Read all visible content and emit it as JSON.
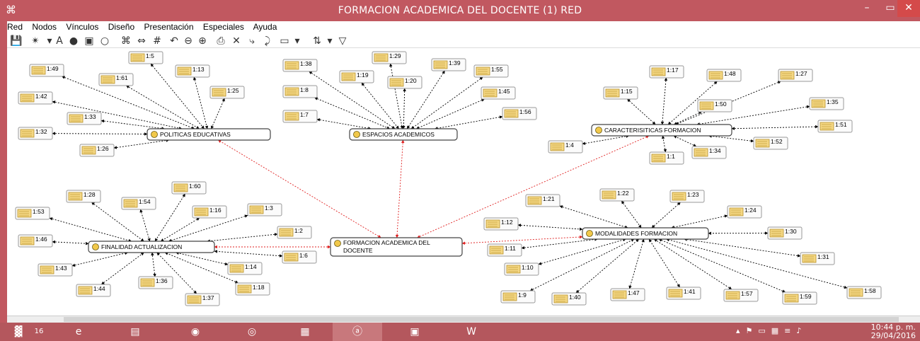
{
  "title": "FORMACION ACADEMICA DEL DOCENTE (1) RED",
  "menu": [
    "Red",
    "Nodos",
    "Vínculos",
    "Diseño",
    "Presentación",
    "Especiales",
    "Ayuda"
  ],
  "codes": [
    {
      "id": "politicas",
      "label": "POLITICAS EDUCATIVAS"
    },
    {
      "id": "espacios",
      "label": "ESPACIOS ACADEMICOS"
    },
    {
      "id": "caracteristicas",
      "label": "CARACTERISITICAS FORMACION"
    },
    {
      "id": "finalidad",
      "label": "FINALIDAD ACTUALIZACION"
    },
    {
      "id": "modalidades",
      "label": "MODALIDADES FORMACION"
    },
    {
      "id": "central",
      "label": "FORMACION ACADEMICA DEL DOCENTE"
    }
  ],
  "quotes": {
    "politicas": [
      "1:49",
      "1:5",
      "1:61",
      "1:13",
      "1:42",
      "1:25",
      "1:33",
      "1:32",
      "1:26"
    ],
    "espacios": [
      "1:38",
      "1:29",
      "1:39",
      "1:19",
      "1:20",
      "1:55",
      "1:8",
      "1:45",
      "1:7",
      "1:56"
    ],
    "caracteristicas": [
      "1:17",
      "1:48",
      "1:27",
      "1:15",
      "1:50",
      "1:35",
      "1:51",
      "1:4",
      "1:52",
      "1:34",
      "1:1"
    ],
    "finalidad": [
      "1:60",
      "1:28",
      "1:54",
      "1:53",
      "1:16",
      "1:3",
      "1:2",
      "1:46",
      "1:6",
      "1:43",
      "1:14",
      "1:36",
      "1:44",
      "1:18",
      "1:37"
    ],
    "modalidades": [
      "1:22",
      "1:23",
      "1:21",
      "1:24",
      "1:12",
      "1:30",
      "1:11",
      "1:10",
      "1:31",
      "1:9",
      "1:40",
      "1:47",
      "1:41",
      "1:57",
      "1:59",
      "1:58"
    ]
  },
  "taskbar": {
    "badge": "16",
    "time": "10:44 p. m.",
    "date": "29/04/2016"
  },
  "colors": {
    "titlebar": "#c15860",
    "link_red": "#e02020",
    "link_black": "#000000"
  }
}
